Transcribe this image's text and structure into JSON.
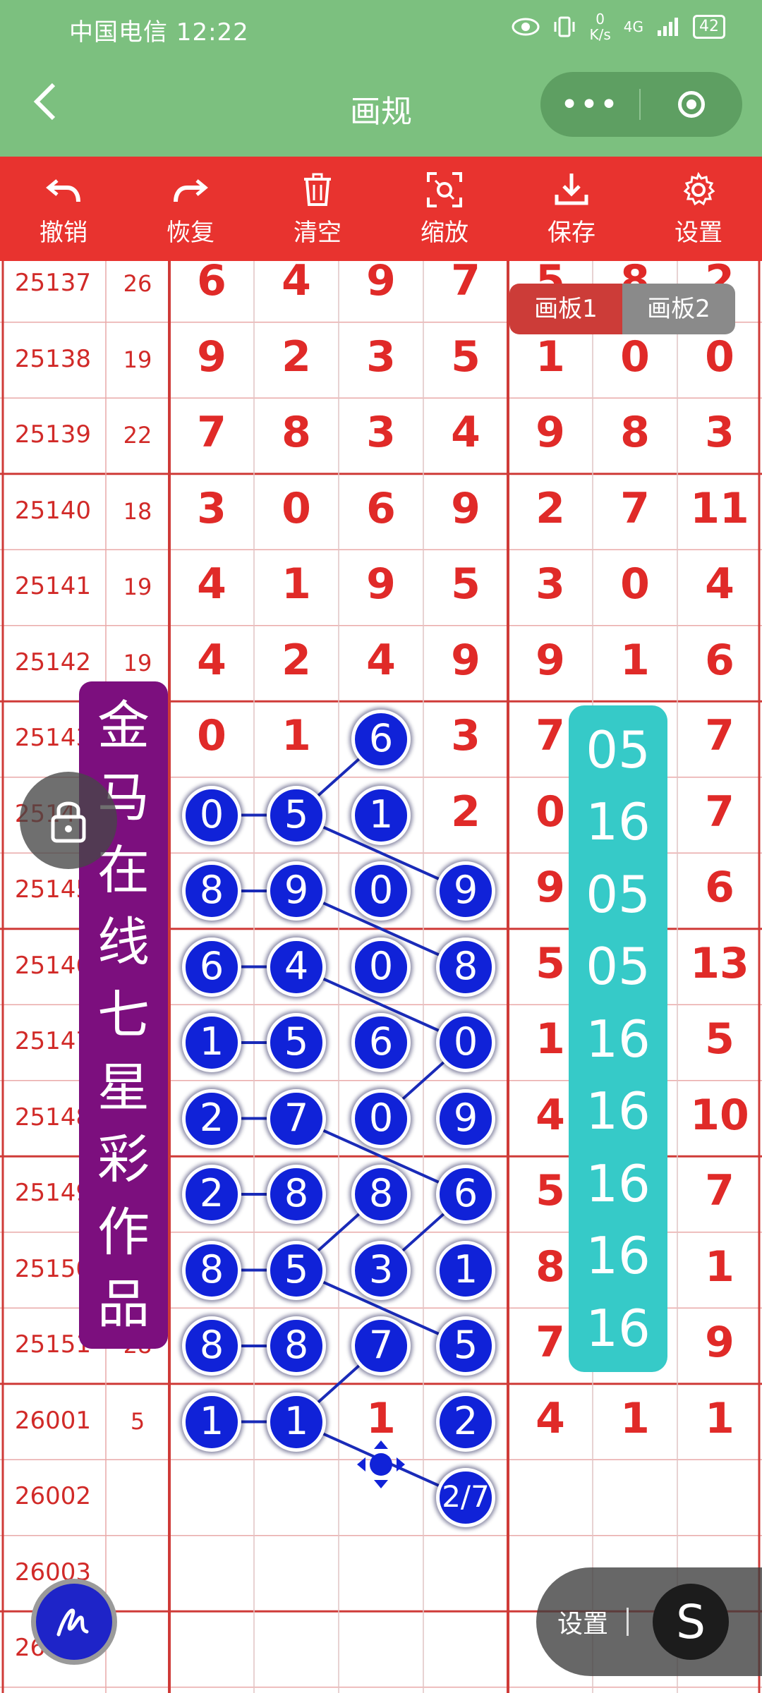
{
  "status": {
    "carrier": "中国电信 12:22",
    "speed_top": "0",
    "speed_bottom": "K/s",
    "network": "4G",
    "battery": "42"
  },
  "nav": {
    "back_icon": "chevron-left-icon",
    "title": "画规",
    "more_label": "•••",
    "target_icon": "target-icon"
  },
  "toolbar": [
    {
      "id": "undo",
      "label": "撤销",
      "icon": "undo-icon"
    },
    {
      "id": "redo",
      "label": "恢复",
      "icon": "redo-icon"
    },
    {
      "id": "clear",
      "label": "清空",
      "icon": "trash-icon"
    },
    {
      "id": "zoom",
      "label": "缩放",
      "icon": "scan-zoom-icon"
    },
    {
      "id": "save",
      "label": "保存",
      "icon": "download-icon"
    },
    {
      "id": "settings",
      "label": "设置",
      "icon": "gear-icon"
    }
  ],
  "board_tabs": [
    "画板1",
    "画板2"
  ],
  "rows": [
    {
      "issue": "25137",
      "sum": "26",
      "digits": [
        "6",
        "4",
        "9",
        "7",
        "5",
        "8",
        "2"
      ]
    },
    {
      "issue": "25138",
      "sum": "19",
      "digits": [
        "9",
        "2",
        "3",
        "5",
        "1",
        "0",
        "0"
      ]
    },
    {
      "issue": "25139",
      "sum": "22",
      "digits": [
        "7",
        "8",
        "3",
        "4",
        "9",
        "8",
        "3"
      ]
    },
    {
      "issue": "25140",
      "sum": "18",
      "digits": [
        "3",
        "0",
        "6",
        "9",
        "2",
        "7",
        "11"
      ]
    },
    {
      "issue": "25141",
      "sum": "19",
      "digits": [
        "4",
        "1",
        "9",
        "5",
        "3",
        "0",
        "4"
      ]
    },
    {
      "issue": "25142",
      "sum": "19",
      "digits": [
        "4",
        "2",
        "4",
        "9",
        "9",
        "1",
        "6"
      ]
    },
    {
      "issue": "25143",
      "sum": "",
      "digits": [
        "0",
        "1",
        "",
        "3",
        "7",
        "",
        "7"
      ]
    },
    {
      "issue": "25144",
      "sum": "",
      "digits": [
        "",
        "",
        "",
        "2",
        "0",
        "",
        "7"
      ]
    },
    {
      "issue": "25145",
      "sum": "",
      "digits": [
        "",
        "",
        "",
        "",
        "9",
        "",
        "6"
      ]
    },
    {
      "issue": "25146",
      "sum": "",
      "digits": [
        "",
        "",
        "",
        "",
        "5",
        "",
        "13"
      ]
    },
    {
      "issue": "25147",
      "sum": "",
      "digits": [
        "",
        "",
        "",
        "",
        "1",
        "",
        "5"
      ]
    },
    {
      "issue": "25148",
      "sum": "",
      "digits": [
        "",
        "",
        "",
        "",
        "4",
        "",
        "10"
      ]
    },
    {
      "issue": "25149",
      "sum": "",
      "digits": [
        "",
        "",
        "",
        "",
        "5",
        "",
        "7"
      ]
    },
    {
      "issue": "25150",
      "sum": "",
      "digits": [
        "",
        "",
        "",
        "",
        "8",
        "",
        "1"
      ]
    },
    {
      "issue": "25151",
      "sum": "28",
      "digits": [
        "",
        "",
        "",
        "",
        "7",
        "",
        "9"
      ]
    },
    {
      "issue": "26001",
      "sum": "5",
      "digits": [
        "",
        "",
        "",
        "",
        "4",
        "1",
        "1"
      ]
    },
    {
      "issue": "26002",
      "sum": "",
      "digits": [
        "",
        "",
        "",
        "",
        "",
        "",
        ""
      ]
    },
    {
      "issue": "26003",
      "sum": "",
      "digits": [
        "",
        "",
        "",
        "",
        "",
        "",
        ""
      ]
    },
    {
      "issue": "26004",
      "sum": "",
      "digits": [
        "",
        "",
        "",
        "",
        "",
        "",
        ""
      ]
    }
  ],
  "balls": [
    {
      "row": 6,
      "col": 2,
      "v": "6"
    },
    {
      "row": 7,
      "col": 0,
      "v": "0"
    },
    {
      "row": 7,
      "col": 1,
      "v": "5"
    },
    {
      "row": 7,
      "col": 2,
      "v": "1"
    },
    {
      "row": 8,
      "col": 0,
      "v": "8"
    },
    {
      "row": 8,
      "col": 1,
      "v": "9"
    },
    {
      "row": 8,
      "col": 2,
      "v": "0"
    },
    {
      "row": 8,
      "col": 3,
      "v": "9"
    },
    {
      "row": 9,
      "col": 0,
      "v": "6"
    },
    {
      "row": 9,
      "col": 1,
      "v": "4"
    },
    {
      "row": 9,
      "col": 2,
      "v": "0"
    },
    {
      "row": 9,
      "col": 3,
      "v": "8"
    },
    {
      "row": 10,
      "col": 0,
      "v": "1"
    },
    {
      "row": 10,
      "col": 1,
      "v": "5"
    },
    {
      "row": 10,
      "col": 2,
      "v": "6"
    },
    {
      "row": 10,
      "col": 3,
      "v": "0"
    },
    {
      "row": 11,
      "col": 0,
      "v": "2"
    },
    {
      "row": 11,
      "col": 1,
      "v": "7"
    },
    {
      "row": 11,
      "col": 2,
      "v": "0"
    },
    {
      "row": 11,
      "col": 3,
      "v": "9"
    },
    {
      "row": 12,
      "col": 0,
      "v": "2"
    },
    {
      "row": 12,
      "col": 1,
      "v": "8"
    },
    {
      "row": 12,
      "col": 2,
      "v": "8"
    },
    {
      "row": 12,
      "col": 3,
      "v": "6"
    },
    {
      "row": 13,
      "col": 0,
      "v": "8"
    },
    {
      "row": 13,
      "col": 1,
      "v": "5"
    },
    {
      "row": 13,
      "col": 2,
      "v": "3"
    },
    {
      "row": 13,
      "col": 3,
      "v": "1"
    },
    {
      "row": 14,
      "col": 0,
      "v": "8"
    },
    {
      "row": 14,
      "col": 1,
      "v": "8"
    },
    {
      "row": 14,
      "col": 2,
      "v": "7"
    },
    {
      "row": 14,
      "col": 3,
      "v": "5"
    },
    {
      "row": 15,
      "col": 0,
      "v": "1"
    },
    {
      "row": 15,
      "col": 1,
      "v": "1"
    },
    {
      "row": 15,
      "col": 3,
      "v": "2"
    },
    {
      "row": 16,
      "col": 3,
      "v": "2/7"
    }
  ],
  "plain_digits": [
    {
      "row": 15,
      "col": 2,
      "v": "1"
    }
  ],
  "links": [
    [
      6,
      2,
      7,
      1
    ],
    [
      7,
      1,
      8,
      3
    ],
    [
      8,
      1,
      9,
      3
    ],
    [
      9,
      1,
      10,
      3
    ],
    [
      10,
      3,
      11,
      2
    ],
    [
      11,
      1,
      12,
      3
    ],
    [
      12,
      3,
      13,
      2
    ],
    [
      12,
      2,
      13,
      1
    ],
    [
      13,
      1,
      14,
      3
    ],
    [
      14,
      2,
      15,
      1
    ],
    [
      15,
      1,
      16,
      3
    ]
  ],
  "banner": {
    "chars": [
      "金",
      "马",
      "在",
      "线",
      "七",
      "星",
      "彩",
      "作",
      "品"
    ]
  },
  "pairs": [
    "05",
    "16",
    "05",
    "05",
    "16",
    "16",
    "16",
    "16",
    "16"
  ],
  "lock_icon": "lock-icon",
  "draw_icon": "pen-icon",
  "settings_float": {
    "label": "设置",
    "icon_glyph": "S"
  }
}
